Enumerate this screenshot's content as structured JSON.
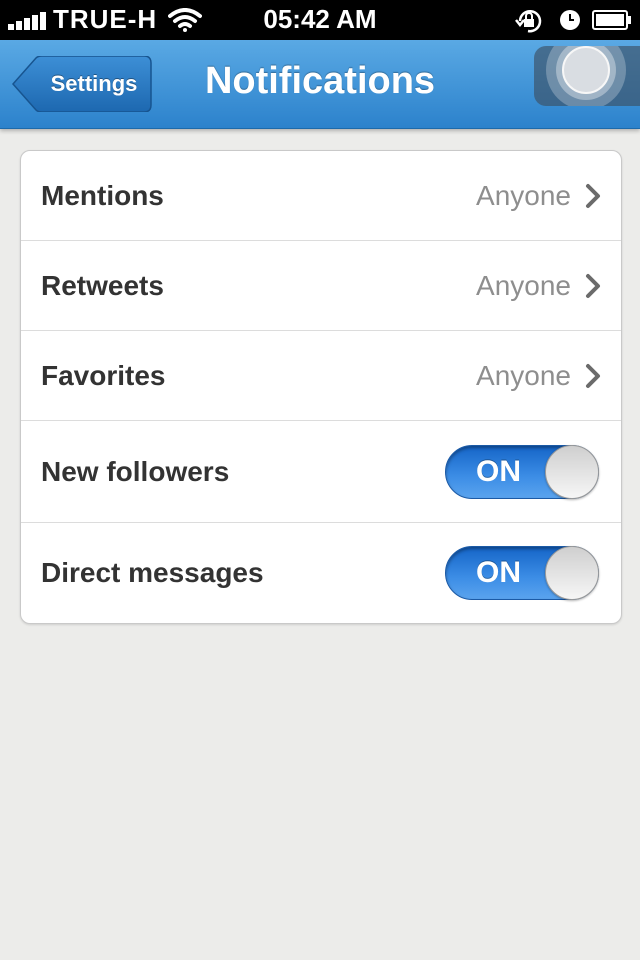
{
  "status_bar": {
    "carrier": "TRUE-H",
    "time": "05:42 AM",
    "icons": [
      "signal-icon",
      "wifi-icon",
      "rotation-lock-icon",
      "alarm-icon",
      "battery-icon"
    ]
  },
  "nav": {
    "back_label": "Settings",
    "title": "Notifications",
    "assistive_touch_icon": "assistive-touch-icon"
  },
  "rows": [
    {
      "label": "Mentions",
      "value": "Anyone",
      "type": "disclosure"
    },
    {
      "label": "Retweets",
      "value": "Anyone",
      "type": "disclosure"
    },
    {
      "label": "Favorites",
      "value": "Anyone",
      "type": "disclosure"
    },
    {
      "label": "New followers",
      "value": "ON",
      "type": "toggle",
      "on": true
    },
    {
      "label": "Direct messages",
      "value": "ON",
      "type": "toggle",
      "on": true
    }
  ],
  "colors": {
    "nav_top": "#5aa9e4",
    "nav_bottom": "#2c82cc",
    "toggle_on": "#2f7fd9",
    "background": "#ececea"
  }
}
